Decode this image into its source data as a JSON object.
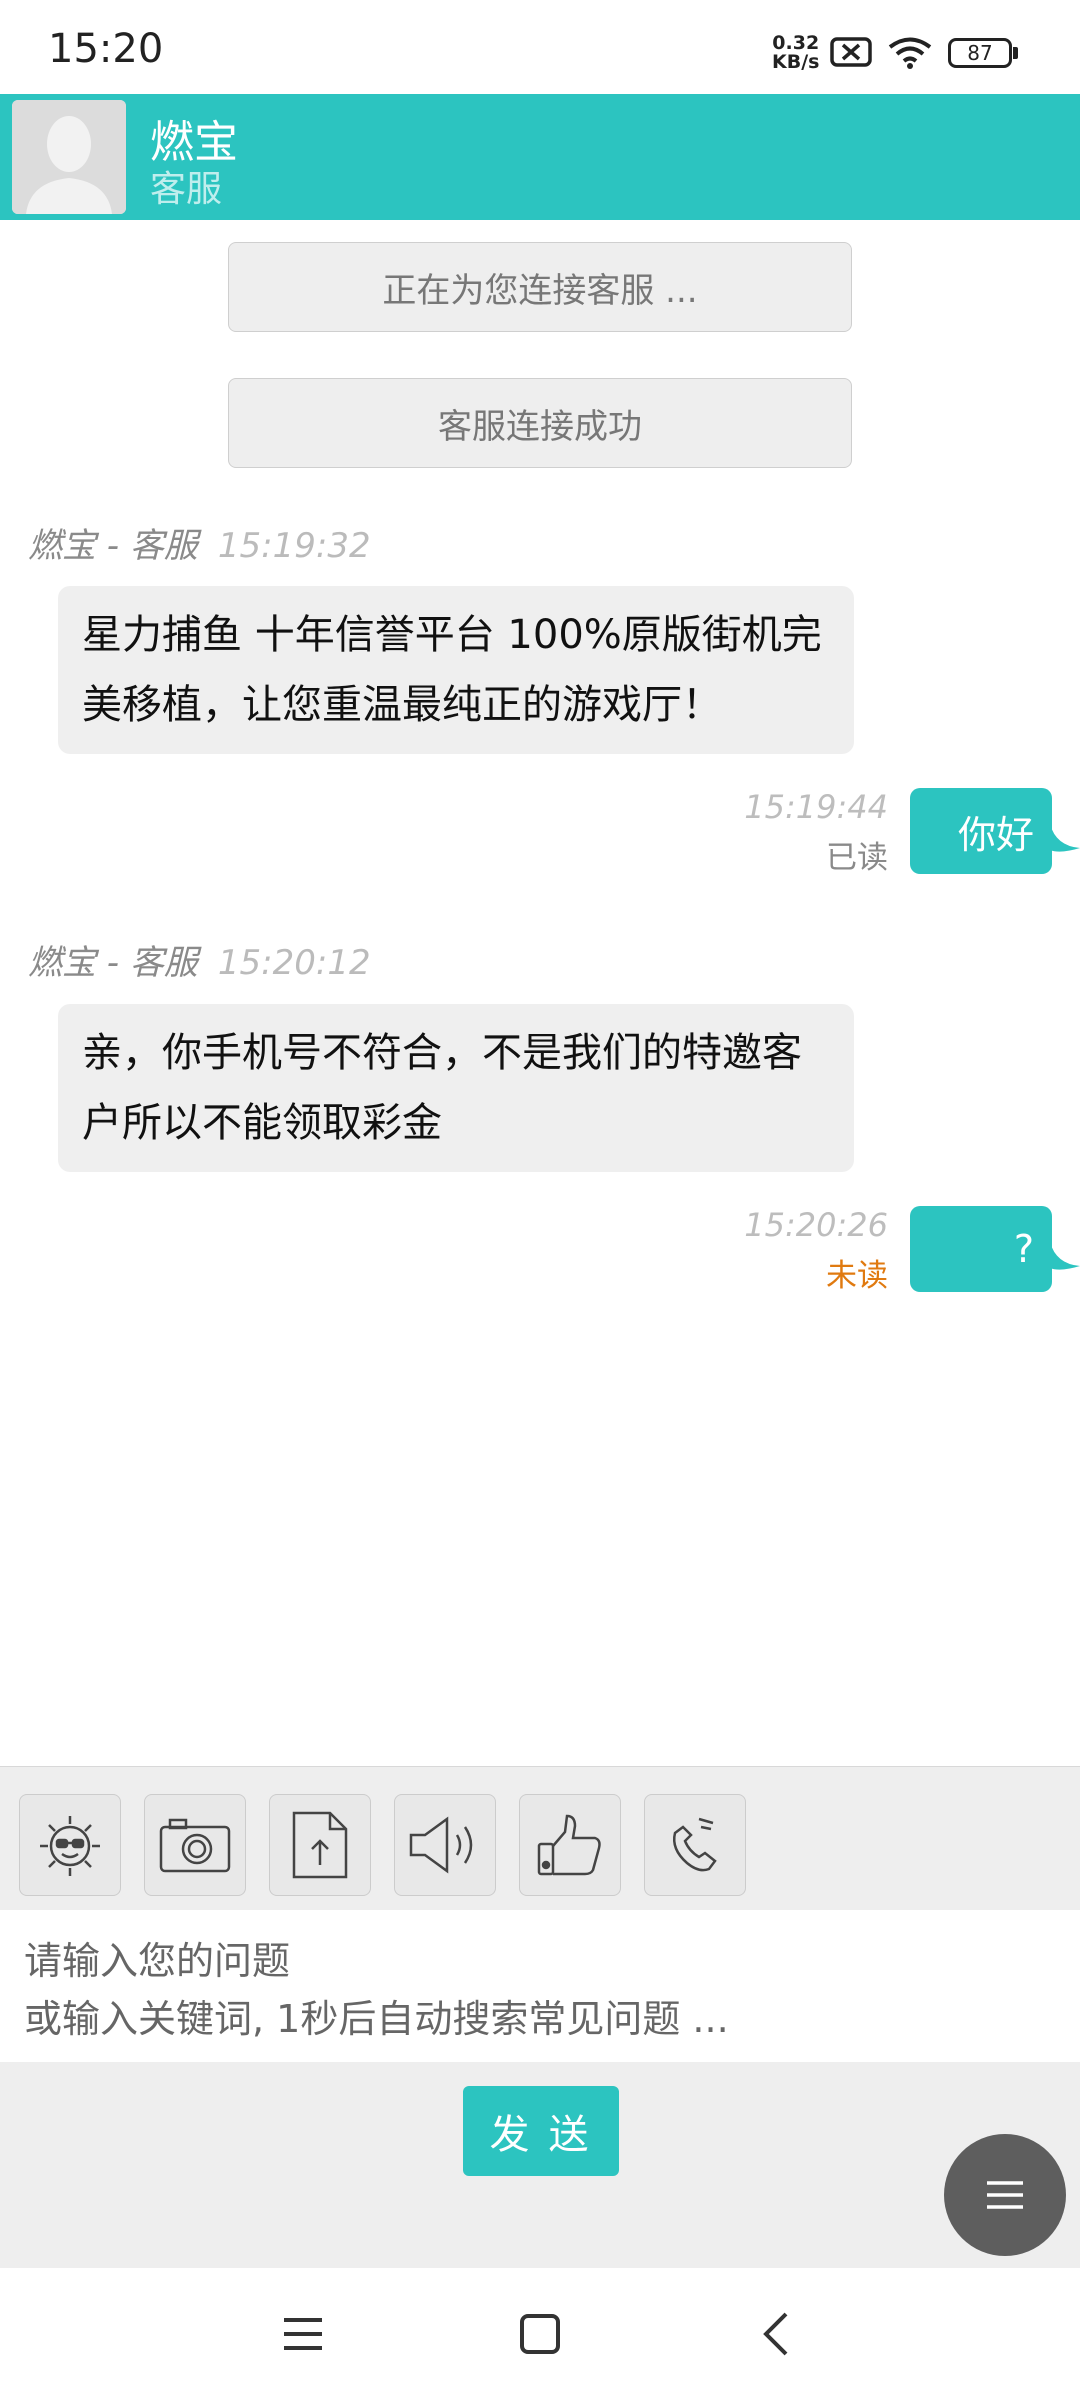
{
  "status_bar": {
    "time": "15:20",
    "net_speed_value": "0.32",
    "net_speed_unit": "KB/s",
    "battery": "87",
    "icons": [
      "sim-x-icon",
      "wifi-icon",
      "battery-icon"
    ]
  },
  "header": {
    "name": "燃宝",
    "role": "客服"
  },
  "system_notices": [
    "正在为您连接客服 ...",
    "客服连接成功"
  ],
  "messages": [
    {
      "meta_name": "燃宝 - 客服",
      "time": "15:19:32",
      "text": "星力捕鱼 十年信誉平台 100%原版街机完美移植，让您重温最纯正的游戏厅！"
    },
    {
      "time": "15:19:44",
      "status": "已读",
      "text": "你好"
    },
    {
      "meta_name": "燃宝 - 客服",
      "time": "15:20:12",
      "text": "亲，你手机号不符合，不是我们的特邀客户所以不能领取彩金"
    },
    {
      "time": "15:20:26",
      "status": "未读",
      "text": "?"
    }
  ],
  "colors": {
    "accent": "#2cc4c0",
    "read": "#8a8a8a",
    "unread": "#e07a10"
  },
  "toolbar": [
    "emoji-icon",
    "camera-icon",
    "upload-icon",
    "volume-icon",
    "thumbs-up-icon",
    "phone-icon"
  ],
  "input": {
    "placeholder": "请输入您的问题\n或输入关键词, 1秒后自动搜索常见问题 ..."
  },
  "send_label": "发 送",
  "nav_bar": [
    "menu-icon",
    "home-icon",
    "back-icon"
  ]
}
